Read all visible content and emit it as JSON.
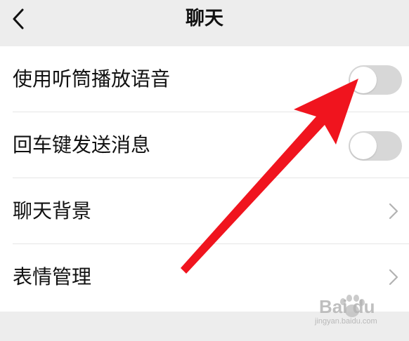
{
  "header": {
    "title": "聊天",
    "back_icon": "chevron-left-icon"
  },
  "settings": [
    {
      "label": "使用听筒播放语音",
      "control": "toggle",
      "enabled": false
    },
    {
      "label": "回车键发送消息",
      "control": "toggle",
      "enabled": false
    },
    {
      "label": "聊天背景",
      "control": "chevron"
    },
    {
      "label": "表情管理",
      "control": "chevron"
    }
  ],
  "annotation": {
    "arrow_color": "#f0141e",
    "points_to": "使用听筒播放语音 toggle"
  },
  "watermark": {
    "text": "Bai du",
    "subtext": "jingyan.baidu.com"
  },
  "colors": {
    "background": "#ededed",
    "list_background": "#ffffff",
    "toggle_off": "#d7d7d7",
    "text": "#111111",
    "chevron": "#b2b2b2"
  }
}
